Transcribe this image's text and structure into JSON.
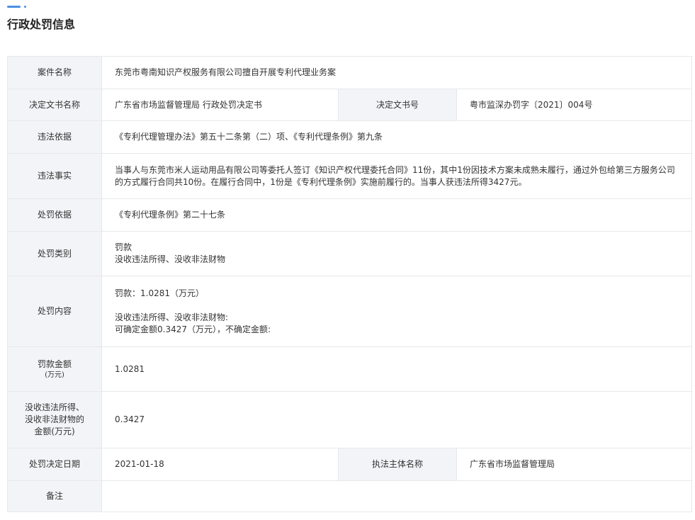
{
  "header": {
    "title": "行政处罚信息",
    "accent_color": "#4a90e2"
  },
  "rows": {
    "case_name": {
      "label": "案件名称",
      "value": "东莞市粤南知识产权服务有限公司擅自开展专利代理业务案"
    },
    "decision": {
      "label": "决定文书名称",
      "value": "广东省市场监督管理局 行政处罚决定书",
      "num_label": "决定文书号",
      "num_value": "粤市监深办罚字〔2021〕004号"
    },
    "violation_basis": {
      "label": "违法依据",
      "value": "《专利代理管理办法》第五十二条第（二）项、《专利代理条例》第九条"
    },
    "violation_facts": {
      "label": "违法事实",
      "value": "当事人与东莞市米人运动用品有限公司等委托人签订《知识产权代理委托合同》11份，其中1份因技术方案未成熟未履行，通过外包给第三方服务公司的方式履行合同共10份。在履行合同中，1份是《专利代理条例》实施前履行的。当事人获违法所得3427元。"
    },
    "penalty_basis": {
      "label": "处罚依据",
      "value": "《专利代理条例》第二十七条"
    },
    "penalty_type": {
      "label": "处罚类别",
      "line1": "罚款",
      "line2": "没收违法所得、没收非法财物"
    },
    "penalty_content": {
      "label": "处罚内容",
      "line1": "罚款：1.0281（万元）",
      "line2": "没收违法所得、没收非法财物:",
      "line3": "可确定金额0.3427（万元），不确定金额:"
    },
    "fine_amount": {
      "label": "罚款金额",
      "label_sub": "(万元)",
      "value": "1.0281"
    },
    "confiscation": {
      "label_line1": "没收违法所得、",
      "label_line2": "没收非法财物的",
      "label_line3": "金额(万元)",
      "value": "0.3427"
    },
    "decision_date": {
      "label": "处罚决定日期",
      "value": "2021-01-18",
      "authority_label": "执法主体名称",
      "authority_value": "广东省市场监督管理局"
    },
    "remarks": {
      "label": "备注",
      "value": ""
    }
  }
}
